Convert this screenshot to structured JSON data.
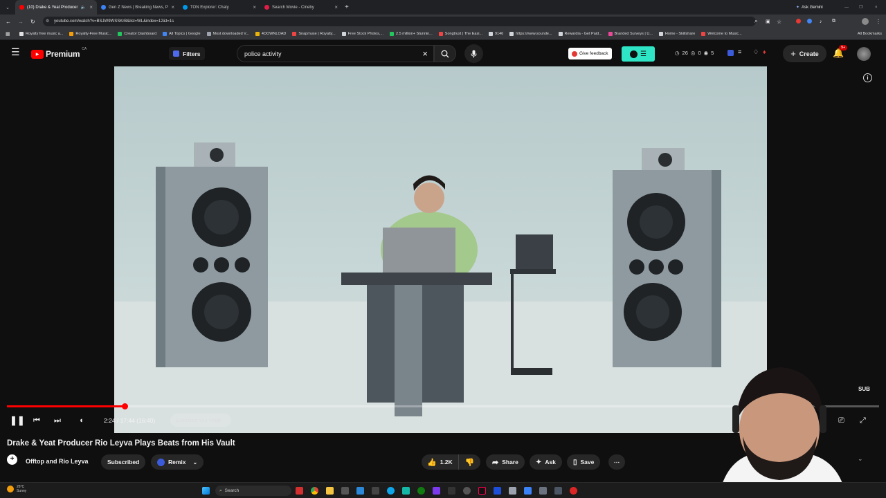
{
  "browser": {
    "tabs": [
      {
        "title": "(10) Drake & Yeat Producer",
        "active": true,
        "color": "#ff0000"
      },
      {
        "title": "Gen Z News | Breaking News, P",
        "active": false,
        "color": "#3b82f6"
      },
      {
        "title": "TON Explorer: Chaty",
        "active": false,
        "color": "#0098ea"
      },
      {
        "title": "Search Movie - Cineby",
        "active": false,
        "color": "#e11d48"
      }
    ],
    "url": "youtube.com/watch?v=BSJW9WSSKrB&list=WL&index=12&t=1s",
    "gemini_label": "Ask Gemini",
    "bookmarks": [
      {
        "label": "Royalty free music a...",
        "color": "#e0e0e0"
      },
      {
        "label": "Royalty-Free Music...",
        "color": "#f59e0b"
      },
      {
        "label": "Creator Dashboard",
        "color": "#22c55e"
      },
      {
        "label": "All Topics | Google",
        "color": "#4285f4"
      },
      {
        "label": "Most downloaded V...",
        "color": "#9ca3af"
      },
      {
        "label": "4DOWNLOAD",
        "color": "#eab308"
      },
      {
        "label": "Snapmuse | Royalty...",
        "color": "#ef4444"
      },
      {
        "label": "Free Stock Photos,...",
        "color": "#d1d5db"
      },
      {
        "label": "2.5 million+ Stunnin...",
        "color": "#22c55e"
      },
      {
        "label": "Songtrust | The Easi...",
        "color": "#ef4444"
      },
      {
        "label": "9146",
        "color": "#d1d5db"
      },
      {
        "label": "https://www.sounde...",
        "color": "#d1d5db"
      },
      {
        "label": "Rewardia - Get Paid...",
        "color": "#d1d5db"
      },
      {
        "label": "Branded Surveys | U...",
        "color": "#ec4899"
      },
      {
        "label": "Home - Skillshare",
        "color": "#d1d5db"
      },
      {
        "label": "Welcome to Music...",
        "color": "#ef4444"
      }
    ],
    "all_bookmarks_label": "All Bookmarks"
  },
  "youtube": {
    "logo_text": "Premium",
    "region": "CA",
    "filters_label": "Filters",
    "search_value": "police activity",
    "feedback_label": "Give feedback",
    "stats": {
      "a": "26",
      "b": "0",
      "c": "5"
    },
    "create_label": "Create",
    "notif_count": "9+"
  },
  "player": {
    "progress_fraction": 0.135,
    "time_label": "2:24 / 17:44 (16:40)",
    "chapter_label": "Surprised You Made",
    "sub_badge": "SUB"
  },
  "video_info": {
    "title": "Drake & Yeat Producer Rio Leyva Plays Beats from His Vault",
    "channel": "Offtop and Rio Leyva",
    "subscribed_label": "Subscribed",
    "remix_label": "Remix",
    "likes": "1.2K",
    "share_label": "Share",
    "ask_label": "Ask",
    "save_label": "Save"
  },
  "taskbar": {
    "weather_temp": "26°C",
    "weather_desc": "Sunny",
    "search_label": "Search"
  }
}
